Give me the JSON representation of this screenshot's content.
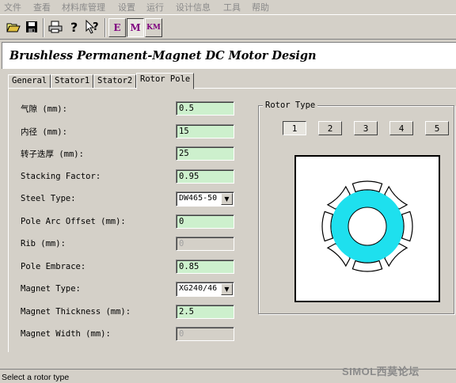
{
  "menu": [
    "文件",
    "查看",
    "材料库管理",
    "设置",
    "运行",
    "设计信息",
    "工具",
    "帮助"
  ],
  "toolbar": {
    "buttons": [
      "open-icon",
      "save-icon",
      "print-icon",
      "help-icon",
      "context-help-icon"
    ],
    "mode_buttons": [
      {
        "label": "E",
        "pressed": false
      },
      {
        "label": "M",
        "pressed": true
      },
      {
        "label": "KM",
        "pressed": false
      }
    ]
  },
  "header": {
    "title": "Brushless Permanent-Magnet DC Motor Design"
  },
  "tabs": [
    {
      "label": "General",
      "active": false
    },
    {
      "label": "Stator1",
      "active": false
    },
    {
      "label": "Stator2",
      "active": false
    },
    {
      "label": "Rotor Pole",
      "active": true
    }
  ],
  "fields": [
    {
      "label": "气隙 (mm):",
      "value": "0.5",
      "kind": "input"
    },
    {
      "label": "内径 (mm):",
      "value": "15",
      "kind": "input"
    },
    {
      "label": "转子迭厚 (mm):",
      "value": "25",
      "kind": "input"
    },
    {
      "label": "Stacking Factor:",
      "value": "0.95",
      "kind": "input"
    },
    {
      "label": "Steel Type:",
      "value": "DW465-50",
      "kind": "select"
    },
    {
      "label": "Pole Arc Offset (mm):",
      "value": "0",
      "kind": "input"
    },
    {
      "label": "Rib (mm):",
      "value": "0",
      "kind": "disabled"
    },
    {
      "label": "Pole Embrace:",
      "value": "0.85",
      "kind": "input"
    },
    {
      "label": "Magnet Type:",
      "value": "XG240/46",
      "kind": "select"
    },
    {
      "label": "Magnet Thickness (mm):",
      "value": "2.5",
      "kind": "input"
    },
    {
      "label": "Magnet Width (mm):",
      "value": "0",
      "kind": "disabled"
    }
  ],
  "rotor_type": {
    "title": "Rotor Type",
    "options": [
      "1",
      "2",
      "3",
      "4",
      "5"
    ],
    "selected": "1"
  },
  "status": {
    "text": "Select a rotor type"
  },
  "watermark": "SIMOL西莫论坛",
  "colors": {
    "input_bg": "#cdf0cd",
    "rotor_core": "#1ee0ee",
    "icon_purple": "#800080"
  }
}
